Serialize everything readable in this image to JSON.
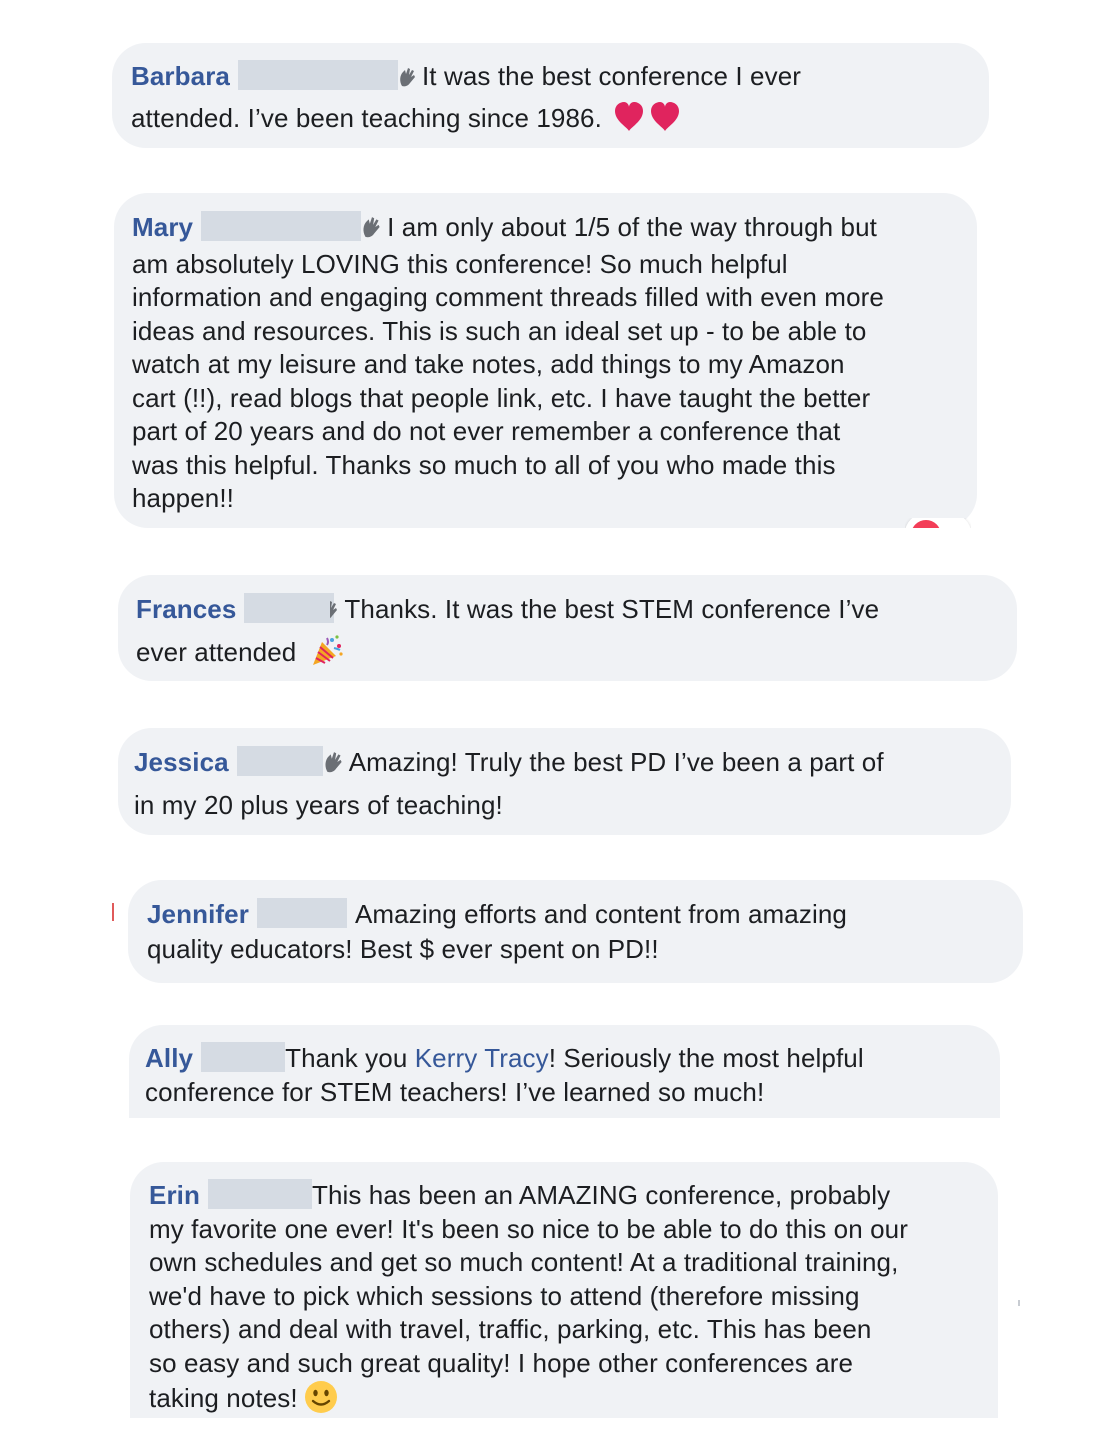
{
  "comments": [
    {
      "author": "Barbara",
      "text1": "It was the best conference I ever",
      "text2": "attended. I’ve been teaching since 1986.",
      "emoji": "heavy-heart-icon ×2"
    },
    {
      "author": "Mary",
      "lines": [
        "I am only about 1/5 of the way through but",
        "am absolutely LOVING this conference! So much helpful",
        "information and engaging comment threads filled with even more",
        "ideas and resources. This is such an ideal set up - to be able to",
        "watch at my leisure and take notes, add things to my Amazon",
        "cart (!!), read blogs that people link, etc. I have taught the better",
        "part of 20 years and do not ever remember a conference that",
        "was this helpful. Thanks so much to all of you who made this",
        "happen!!"
      ]
    },
    {
      "author": "Frances",
      "text1": "Thanks. It was the best STEM conference I’ve",
      "text2": "ever attended",
      "emoji": "party-popper-icon"
    },
    {
      "author": "Jessica",
      "text1": "Amazing! Truly the best PD I’ve been a part of",
      "text2": "in my 20 plus years of teaching!"
    },
    {
      "author": "Jennifer",
      "text1": "Amazing efforts and content from amazing",
      "text2": "quality educators! Best $ ever spent on PD!!"
    },
    {
      "author": "Ally",
      "text1a": "Thank you ",
      "mention": "Kerry Tracy",
      "text1b": "! Seriously the most helpful",
      "text2": "conference for STEM teachers! I’ve learned so much!"
    },
    {
      "author": "Erin",
      "lines": [
        "This has been an AMAZING conference, probably",
        "my favorite one ever! It's been so nice to be able to do this on our",
        "own schedules and get so much content! At a traditional training,",
        "we'd have to pick which sessions to attend (therefore missing",
        "others) and deal with travel, traffic, parking, etc. This has been",
        "so easy and such great quality! I hope other conferences are",
        "taking notes!"
      ],
      "emoji": "slightly-smiling-face-icon"
    }
  ],
  "colors": {
    "bubble": "#f0f2f5",
    "author": "#365899",
    "text": "#1c1e21",
    "redaction": "#d5dbe3",
    "heart": "#e0245e"
  }
}
